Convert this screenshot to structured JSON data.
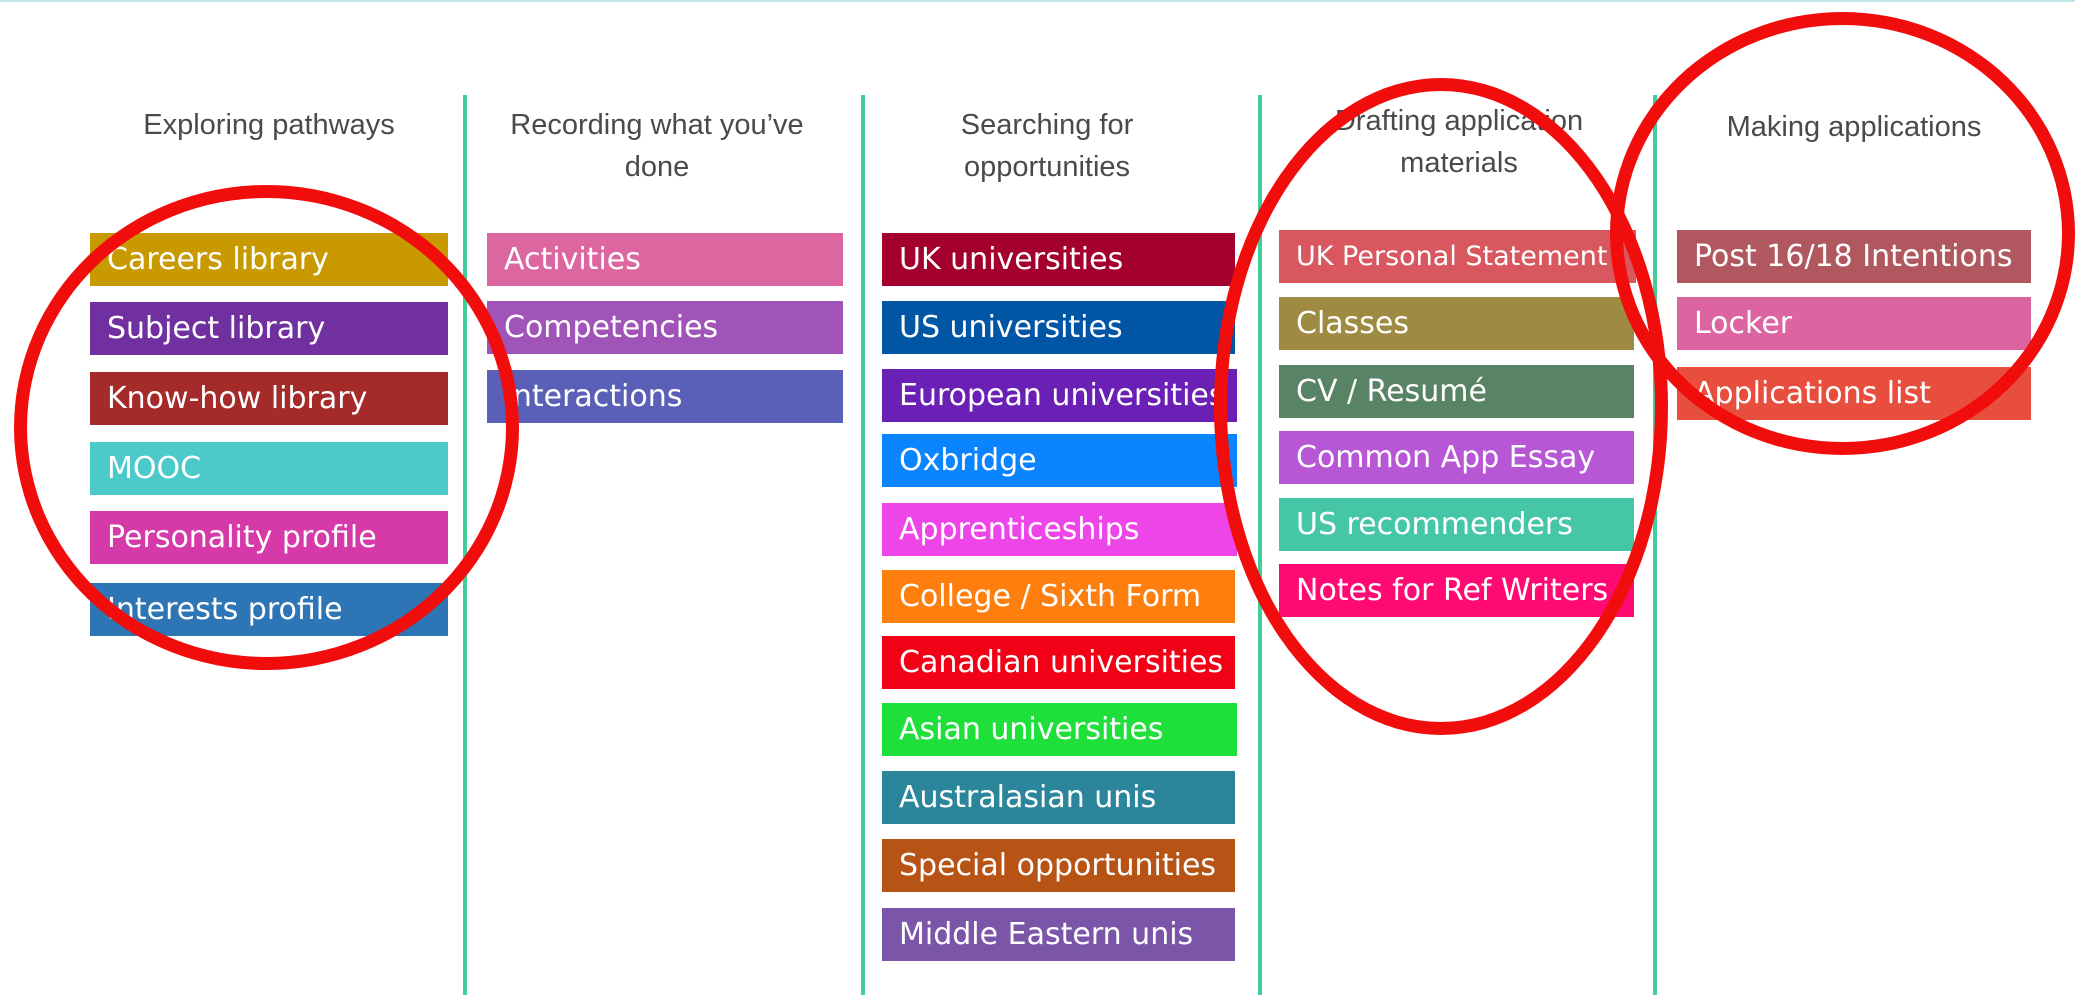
{
  "columns": [
    {
      "title": "Exploring pathways",
      "items": [
        {
          "label": "Careers library",
          "color": "#c89a00"
        },
        {
          "label": "Subject library",
          "color": "#7030a0"
        },
        {
          "label": "Know-how library",
          "color": "#a52a2a"
        },
        {
          "label": "MOOC",
          "color": "#4cc9c9"
        },
        {
          "label": "Personality profile",
          "color": "#d63aa8"
        },
        {
          "label": "Interests profile",
          "color": "#2e75b6"
        }
      ]
    },
    {
      "title": "Recording what you’ve done",
      "items": [
        {
          "label": "Activities",
          "color": "#dc67a0"
        },
        {
          "label": "Competencies",
          "color": "#a154b8"
        },
        {
          "label": "Interactions",
          "color": "#5a5fb8"
        }
      ]
    },
    {
      "title": "Searching for opportunities",
      "items": [
        {
          "label": "UK universities",
          "color": "#a3002e"
        },
        {
          "label": "US universities",
          "color": "#0055a5"
        },
        {
          "label": "European universities",
          "color": "#6a1fb5"
        },
        {
          "label": "Oxbridge",
          "color": "#0a84ff"
        },
        {
          "label": "Apprenticeships",
          "color": "#ee45e8"
        },
        {
          "label": "College / Sixth Form",
          "color": "#ff7f0e"
        },
        {
          "label": "Canadian universities",
          "color": "#f20016"
        },
        {
          "label": "Asian universities",
          "color": "#1fe03a"
        },
        {
          "label": "Australasian unis",
          "color": "#2b869b"
        },
        {
          "label": "Special opportunities",
          "color": "#b85316"
        },
        {
          "label": "Middle Eastern unis",
          "color": "#7a55a8"
        }
      ]
    },
    {
      "title": "Drafting application materials",
      "items": [
        {
          "label": "UK Personal Statement",
          "color": "#d9575f"
        },
        {
          "label": "Classes",
          "color": "#9f8a41"
        },
        {
          "label": "CV / Resumé",
          "color": "#588364"
        },
        {
          "label": "Common App Essay",
          "color": "#b757d6"
        },
        {
          "label": "US recommenders",
          "color": "#45c6a7"
        },
        {
          "label": "Notes for Ref Writers",
          "color": "#ff0a72"
        }
      ]
    },
    {
      "title": "Making applications",
      "items": [
        {
          "label": "Post 16/18 Intentions",
          "color": "#b0575f"
        },
        {
          "label": "Locker",
          "color": "#dc64a0"
        },
        {
          "label": "Applications list",
          "color": "#e84e3e"
        }
      ]
    }
  ]
}
